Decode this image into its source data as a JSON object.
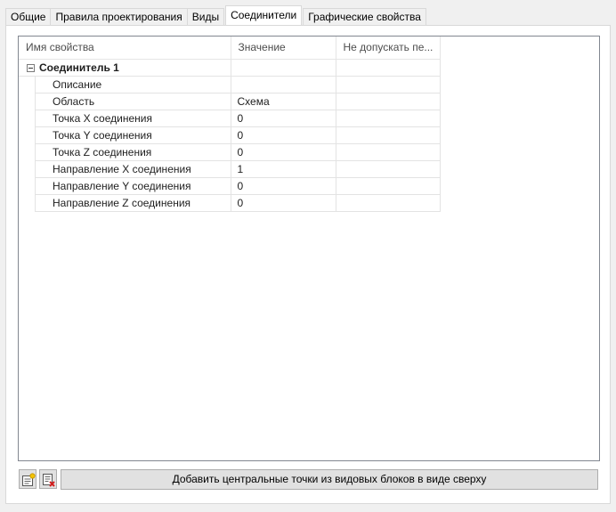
{
  "tabs": [
    {
      "label": "Общие"
    },
    {
      "label": "Правила проектирования"
    },
    {
      "label": "Виды"
    },
    {
      "label": "Соединители"
    },
    {
      "label": "Графические свойства"
    }
  ],
  "active_tab": "Соединители",
  "grid": {
    "columns": [
      "Имя свойства",
      "Значение",
      "Не допускать пе..."
    ],
    "group": {
      "name": "Соединитель 1",
      "expanded": true
    },
    "rows": [
      {
        "name": "Описание",
        "value": "",
        "lock": ""
      },
      {
        "name": "Область",
        "value": "Схема",
        "lock": ""
      },
      {
        "name": "Точка X соединения",
        "value": "0",
        "lock": ""
      },
      {
        "name": "Точка Y соединения",
        "value": "0",
        "lock": ""
      },
      {
        "name": "Точка Z соединения",
        "value": "0",
        "lock": ""
      },
      {
        "name": "Направление X соединения",
        "value": "1",
        "lock": ""
      },
      {
        "name": "Направление Y соединения",
        "value": "0",
        "lock": ""
      },
      {
        "name": "Направление Z соединения",
        "value": "0",
        "lock": ""
      }
    ]
  },
  "buttons": {
    "add_icon": "add-connector-icon",
    "delete_icon": "delete-connector-icon",
    "action_label": "Добавить центральные точки из видовых блоков в виде сверху"
  }
}
